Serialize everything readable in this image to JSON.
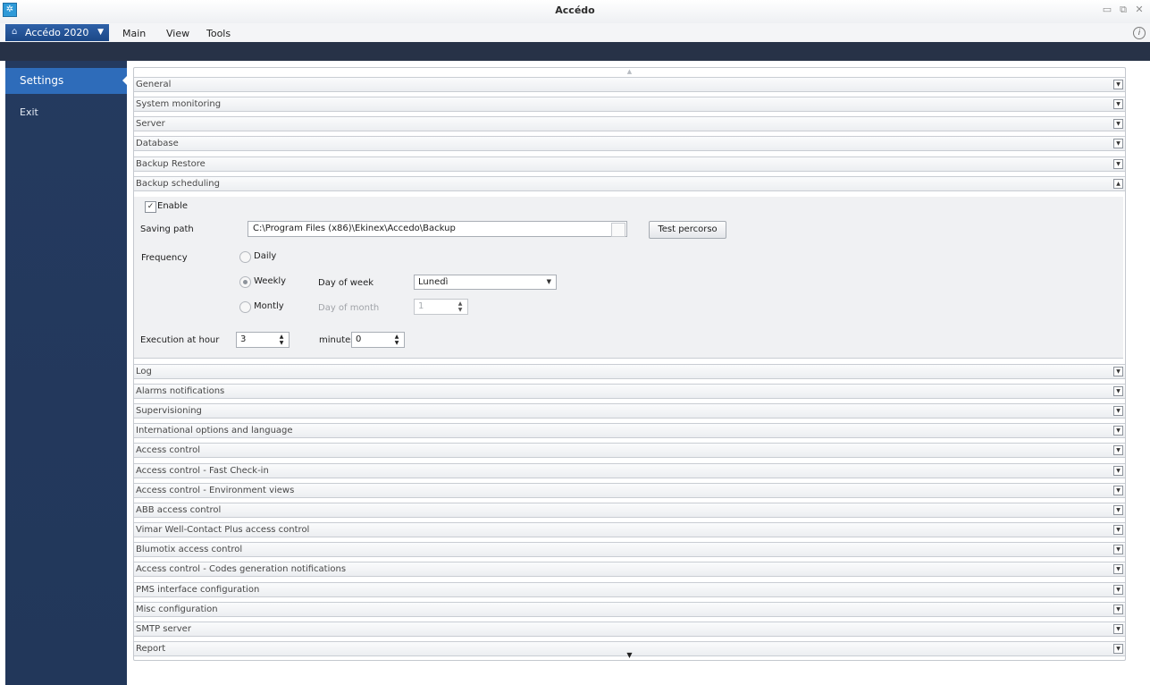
{
  "window": {
    "title": "Accédo",
    "controls": {
      "minimize": "▭",
      "restore": "⧉",
      "close": "✕"
    }
  },
  "menubar": {
    "app_button": "Accédo 2020",
    "items": [
      "Main",
      "View",
      "Tools"
    ],
    "info": "i"
  },
  "sidebar": {
    "items": [
      {
        "label": "Settings",
        "active": true
      },
      {
        "label": "Exit",
        "active": false
      }
    ]
  },
  "sections_before": [
    {
      "label": "General",
      "expanded": false
    },
    {
      "label": "System monitoring",
      "expanded": false
    },
    {
      "label": "Server",
      "expanded": false
    },
    {
      "label": "Database",
      "expanded": false
    },
    {
      "label": "Backup Restore",
      "expanded": false
    },
    {
      "label": "Backup scheduling",
      "expanded": true
    }
  ],
  "backup_scheduling": {
    "enable_label": "Enable",
    "enable_checked": true,
    "saving_path_label": "Saving path",
    "saving_path_value": "C:\\Program Files (x86)\\Ekinex\\Accedo\\Backup",
    "test_button": "Test percorso",
    "frequency_label": "Frequency",
    "daily_label": "Daily",
    "weekly_label": "Weekly",
    "montly_label": "Montly",
    "frequency_selected": "Weekly",
    "day_of_week_label": "Day of week",
    "day_of_week_value": "Lunedì",
    "day_of_month_label": "Day of month",
    "day_of_month_value": "1",
    "execution_label": "Execution at hour",
    "hour_value": "3",
    "minutes_label": "minutes",
    "minutes_value": "0"
  },
  "sections_after": [
    {
      "label": "Log",
      "expanded": false
    },
    {
      "label": "Alarms notifications",
      "expanded": false
    },
    {
      "label": "Supervisioning",
      "expanded": false
    },
    {
      "label": "International options and language",
      "expanded": false
    },
    {
      "label": "Access control",
      "expanded": false
    },
    {
      "label": "Access control - Fast Check-in",
      "expanded": false
    },
    {
      "label": "Access control - Environment views",
      "expanded": false
    },
    {
      "label": "ABB access control",
      "expanded": false
    },
    {
      "label": "Vimar Well-Contact Plus access control",
      "expanded": false
    },
    {
      "label": "Blumotix access control",
      "expanded": false
    },
    {
      "label": "Access control - Codes generation notifications",
      "expanded": false
    },
    {
      "label": "PMS interface configuration",
      "expanded": false
    },
    {
      "label": "Misc configuration",
      "expanded": false
    },
    {
      "label": "SMTP server",
      "expanded": false
    },
    {
      "label": "Report",
      "expanded": false
    }
  ],
  "colors": {
    "sidebar_bg": "#233a5e",
    "sidebar_active": "#2e6cba",
    "ribbon_band": "#273247",
    "app_button": "#2a5aa0"
  }
}
